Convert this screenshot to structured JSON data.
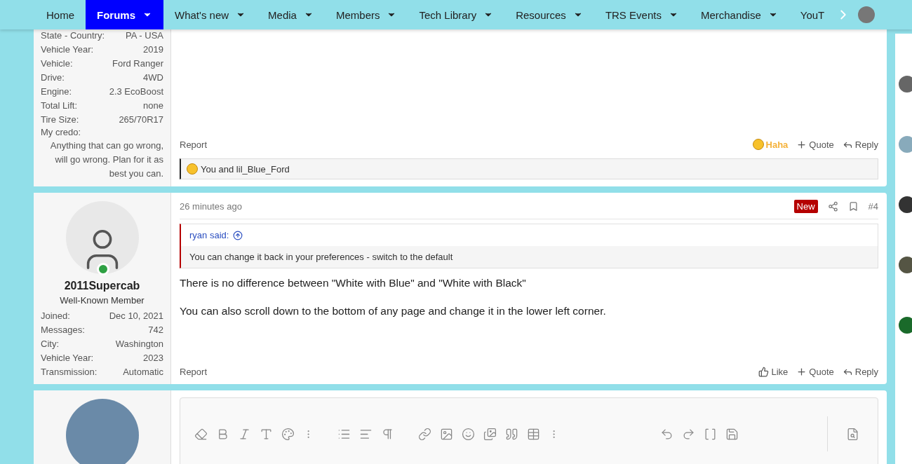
{
  "nav": {
    "items": [
      {
        "label": "Home",
        "selected": false,
        "has_menu": false
      },
      {
        "label": "Forums",
        "selected": true,
        "has_menu": true
      },
      {
        "label": "What's new",
        "selected": false,
        "has_menu": true
      },
      {
        "label": "Media",
        "selected": false,
        "has_menu": true
      },
      {
        "label": "Members",
        "selected": false,
        "has_menu": true
      },
      {
        "label": "Tech Library",
        "selected": false,
        "has_menu": true
      },
      {
        "label": "Resources",
        "selected": false,
        "has_menu": true
      },
      {
        "label": "TRS Events",
        "selected": false,
        "has_menu": true
      },
      {
        "label": "Merchandise",
        "selected": false,
        "has_menu": true
      },
      {
        "label": "YouT",
        "selected": false,
        "has_menu": false
      }
    ]
  },
  "posts": [
    {
      "kind": "post",
      "cut_top": true,
      "user": {
        "fields": [
          {
            "label": "State - Country:",
            "value": "PA - USA"
          },
          {
            "label": "Vehicle Year:",
            "value": "2019"
          },
          {
            "label": "Vehicle:",
            "value": "Ford Ranger"
          },
          {
            "label": "Drive:",
            "value": "4WD"
          },
          {
            "label": "Engine:",
            "value": "2.3 EcoBoost"
          },
          {
            "label": "Total Lift:",
            "value": "none"
          },
          {
            "label": "Tire Size:",
            "value": "265/70R17"
          }
        ],
        "credo_label": "My credo:",
        "credo": "Anything that can go wrong, will go wrong. Plan for it as best you can."
      },
      "footer": {
        "report": "Report",
        "actions": [
          {
            "kind": "reaction",
            "label": "Haha",
            "selected": true
          },
          {
            "kind": "quote",
            "label": "Quote"
          },
          {
            "kind": "reply",
            "label": "Reply"
          }
        ]
      },
      "reactions": "You and lil_Blue_Ford"
    },
    {
      "kind": "post",
      "cut_top": false,
      "user": {
        "name": "2011Supercab",
        "title": "Well-Known Member",
        "online": true,
        "fields": [
          {
            "label": "Joined:",
            "value": "Dec 10, 2021"
          },
          {
            "label": "Messages:",
            "value": "742"
          },
          {
            "label": "City:",
            "value": "Washington"
          },
          {
            "label": "Vehicle Year:",
            "value": "2023"
          },
          {
            "label": "Transmission:",
            "value": "Automatic"
          }
        ]
      },
      "header": {
        "time": "26 minutes ago",
        "badge": "New",
        "number": "#4"
      },
      "quote": {
        "author": "ryan said:",
        "text": "You can change it back in your preferences - switch to the default"
      },
      "paragraphs": [
        "There is no difference between \"White with Blue\" and \"White with Black\"",
        "You can also scroll down to the bottom of any page and change it in the lower left corner."
      ],
      "footer": {
        "report": "Report",
        "actions": [
          {
            "kind": "reaction",
            "label": "Like",
            "selected": false
          },
          {
            "kind": "quote",
            "label": "Quote"
          },
          {
            "kind": "reply",
            "label": "Reply"
          }
        ]
      }
    },
    {
      "kind": "editor"
    }
  ]
}
